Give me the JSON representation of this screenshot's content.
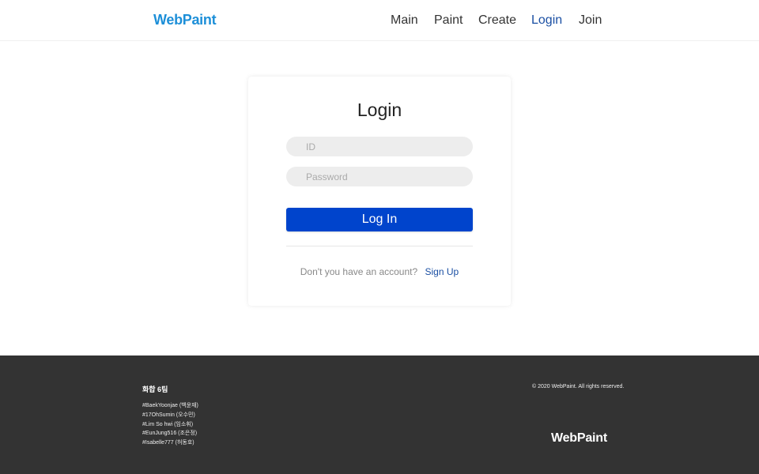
{
  "header": {
    "logo": "WebPaint",
    "nav": [
      {
        "label": "Main"
      },
      {
        "label": "Paint"
      },
      {
        "label": "Create"
      },
      {
        "label": "Login"
      },
      {
        "label": "Join"
      }
    ],
    "active_item": "Login"
  },
  "login": {
    "title": "Login",
    "id_placeholder": "ID",
    "password_placeholder": "Password",
    "submit_label": "Log In",
    "signup_prompt": "Don't you have an account?",
    "signup_link": "Sign Up"
  },
  "footer": {
    "team_title": "화합 6팀",
    "members": [
      "#BaekYoonjae (백윤재)",
      "#17OhSumin (오수민)",
      "#Lim So hwi (임소휘)",
      "#EunJung516 (조은정)",
      "#Isabelle777 (허동호)"
    ],
    "copyright": "© 2020 WebPaint. All rights reserved.",
    "logo": "WebPaint"
  },
  "colors": {
    "brand": "#1d8fd8",
    "primary_button": "#0044cc",
    "active_nav": "#1a4fa3",
    "footer_bg": "#333333"
  }
}
